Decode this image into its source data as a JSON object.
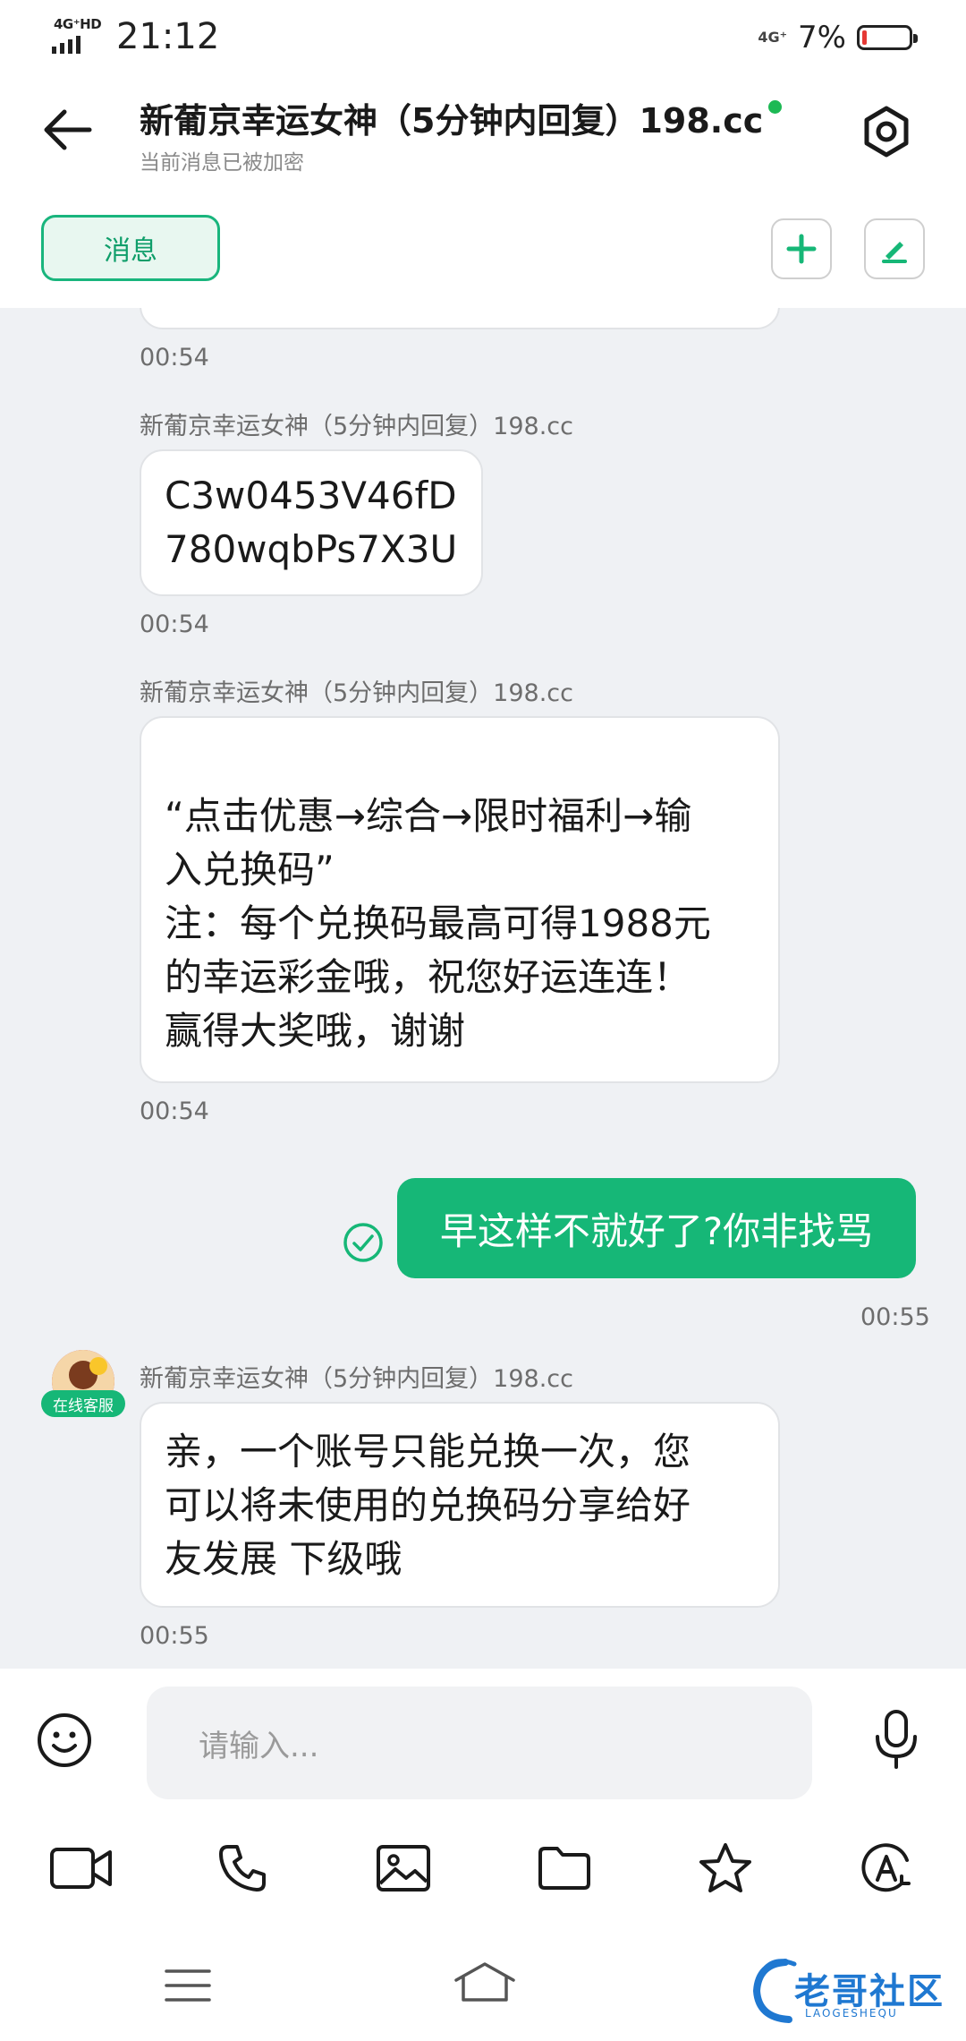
{
  "status_bar": {
    "network_tag": "4G⁺HD",
    "time": "21:12",
    "network_right": "4G⁺",
    "battery_text": "7%",
    "battery_level": 0.07
  },
  "header": {
    "title": "新葡京幸运女神（5分钟内回复）198.cc",
    "subtitle": "当前消息已被加密",
    "online_color": "#1db954"
  },
  "tabs": {
    "active_tab": "消息"
  },
  "messages": [
    {
      "type": "incoming",
      "sender": "",
      "text": "",
      "time": "00:54"
    },
    {
      "type": "incoming",
      "sender": "新葡京幸运女神（5分钟内回复）198.cc",
      "lines": [
        "C3w0453V46fD",
        "780wqbPs7X3U"
      ],
      "time": "00:54"
    },
    {
      "type": "incoming",
      "sender": "新葡京幸运女神（5分钟内回复）198.cc",
      "lines": [
        "“点击优惠→综合→限时福利→输",
        "入兑换码”",
        "注：每个兑换码最高可得1988元",
        "的幸运彩金哦，祝您好运连连！",
        "赢得大奖哦，谢谢"
      ],
      "time": "00:54"
    },
    {
      "type": "outgoing",
      "text": "早这样不就好了?你非找骂",
      "time": "00:55"
    },
    {
      "type": "incoming",
      "sender": "新葡京幸运女神（5分钟内回复）198.cc",
      "avatar_badge": "在线客服",
      "lines": [
        "亲，一个账号只能兑换一次，您",
        "可以将未使用的兑换码分享给好",
        "友发展 下级哦"
      ],
      "time": "00:55"
    }
  ],
  "input": {
    "placeholder": "请输入..."
  },
  "watermark": {
    "text": "老哥社区",
    "sub": "LAOGESHEQU"
  },
  "colors": {
    "accent_green": "#16b777",
    "chat_bg": "#eff1f4"
  }
}
